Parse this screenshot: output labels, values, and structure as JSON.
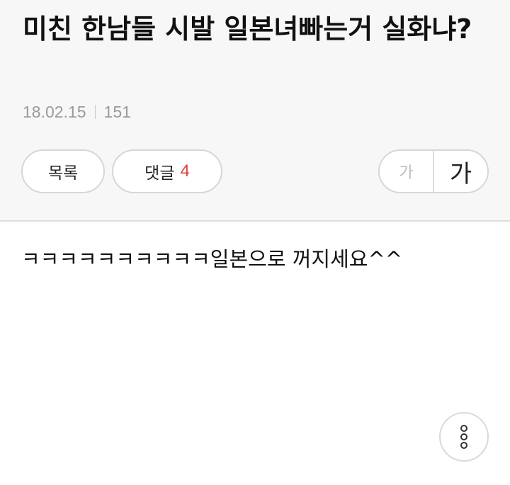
{
  "post": {
    "title": "미친 한남들 시발 일본녀빠는거 실화냐?",
    "date": "18.02.15",
    "views": "151",
    "content": "ㅋㅋㅋㅋㅋㅋㅋㅋㅋㅋ일본으로 꺼지세요^^"
  },
  "actions": {
    "list_label": "목록",
    "comment_label": "댓글",
    "comment_count": "4",
    "font_small_label": "가",
    "font_large_label": "가"
  },
  "icons": {
    "more": "vertical-dots-icon"
  },
  "colors": {
    "header_bg": "#f7f7f7",
    "comment_count": "#e0423a",
    "meta_text": "#9a9a9a"
  }
}
